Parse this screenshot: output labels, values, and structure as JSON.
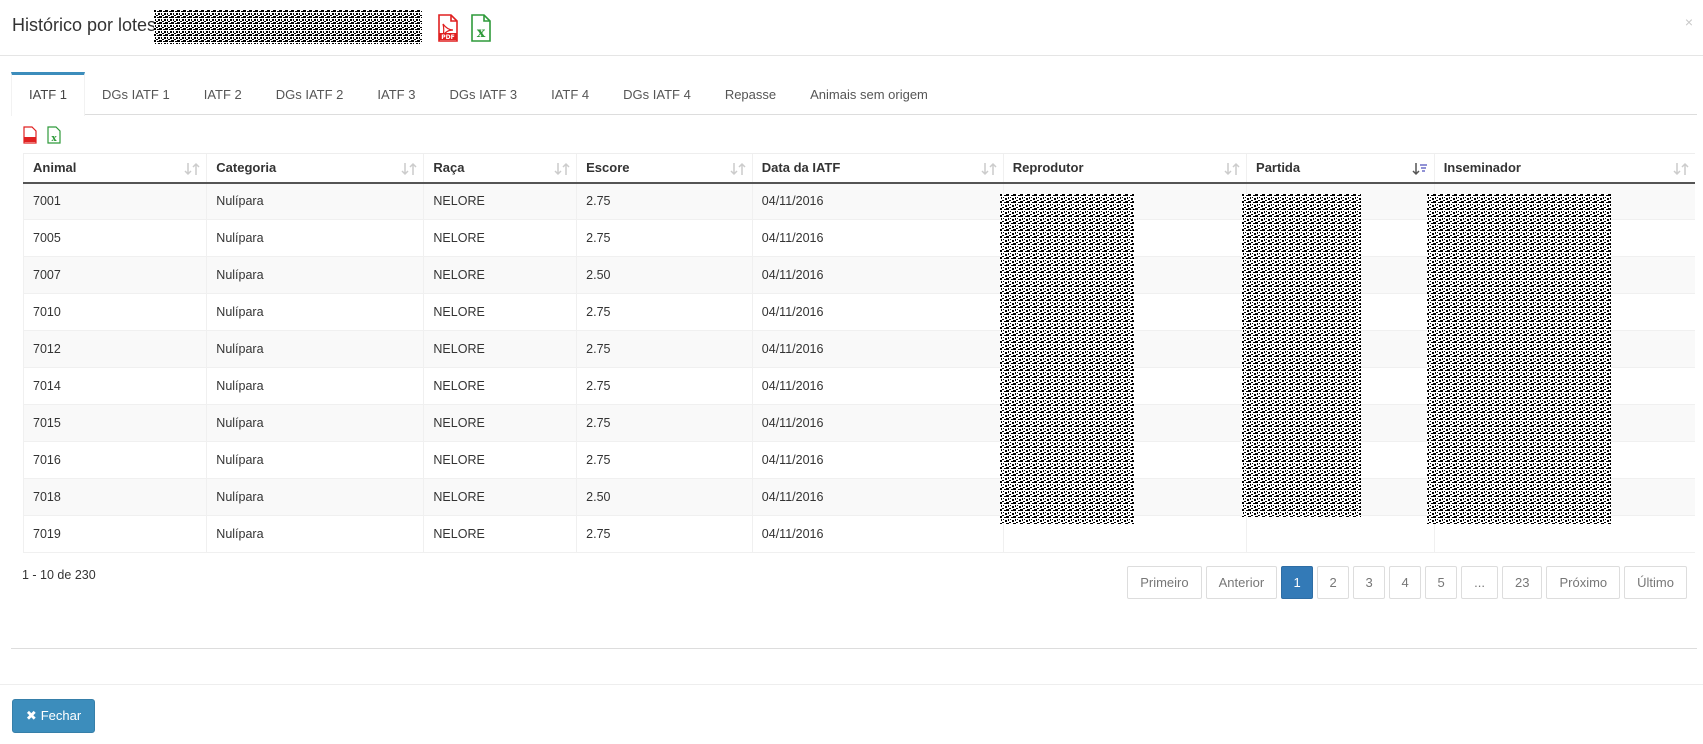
{
  "modal": {
    "title": "Histórico por lotes",
    "pdf_icon": "pdf-file-icon",
    "excel_icon": "excel-file-icon",
    "close_symbol": "×"
  },
  "tabs": [
    {
      "label": "IATF 1",
      "active": true
    },
    {
      "label": "DGs IATF 1"
    },
    {
      "label": "IATF 2"
    },
    {
      "label": "DGs IATF 2"
    },
    {
      "label": "IATF 3"
    },
    {
      "label": "DGs IATF 3"
    },
    {
      "label": "IATF 4"
    },
    {
      "label": "DGs IATF 4"
    },
    {
      "label": "Repasse"
    },
    {
      "label": "Animais sem origem"
    }
  ],
  "table": {
    "columns": [
      "Animal",
      "Categoria",
      "Raça",
      "Escore",
      "Data da IATF",
      "Reprodutor",
      "Partida",
      "Inseminador"
    ],
    "sorted_column": "Partida",
    "rows": [
      {
        "animal": "7001",
        "categoria": "Nulípara",
        "raca": "NELORE",
        "escore": "2.75",
        "data": "04/11/2016"
      },
      {
        "animal": "7005",
        "categoria": "Nulípara",
        "raca": "NELORE",
        "escore": "2.75",
        "data": "04/11/2016"
      },
      {
        "animal": "7007",
        "categoria": "Nulípara",
        "raca": "NELORE",
        "escore": "2.50",
        "data": "04/11/2016"
      },
      {
        "animal": "7010",
        "categoria": "Nulípara",
        "raca": "NELORE",
        "escore": "2.75",
        "data": "04/11/2016"
      },
      {
        "animal": "7012",
        "categoria": "Nulípara",
        "raca": "NELORE",
        "escore": "2.75",
        "data": "04/11/2016"
      },
      {
        "animal": "7014",
        "categoria": "Nulípara",
        "raca": "NELORE",
        "escore": "2.75",
        "data": "04/11/2016"
      },
      {
        "animal": "7015",
        "categoria": "Nulípara",
        "raca": "NELORE",
        "escore": "2.75",
        "data": "04/11/2016"
      },
      {
        "animal": "7016",
        "categoria": "Nulípara",
        "raca": "NELORE",
        "escore": "2.75",
        "data": "04/11/2016"
      },
      {
        "animal": "7018",
        "categoria": "Nulípara",
        "raca": "NELORE",
        "escore": "2.50",
        "data": "04/11/2016"
      },
      {
        "animal": "7019",
        "categoria": "Nulípara",
        "raca": "NELORE",
        "escore": "2.75",
        "data": "04/11/2016"
      }
    ]
  },
  "info": "1 - 10 de 230",
  "pagination": {
    "first": "Primeiro",
    "prev": "Anterior",
    "pages": [
      "1",
      "2",
      "3",
      "4",
      "5",
      "...",
      "23"
    ],
    "current": "1",
    "next": "Próximo",
    "last": "Último"
  },
  "footer": {
    "close_label": "Fechar"
  },
  "colors": {
    "accent": "#3c8dbc",
    "page_active": "#337ab7",
    "pdf_red": "#e02020",
    "excel_green": "#2e9a3a"
  }
}
